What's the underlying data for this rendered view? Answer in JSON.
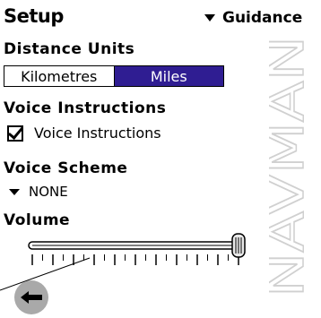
{
  "header": {
    "title": "Setup",
    "menu_label": "Guidance"
  },
  "distance": {
    "heading": "Distance Units",
    "options": [
      "Kilometres",
      "Miles"
    ],
    "selected": "Miles"
  },
  "voice": {
    "heading": "Voice Instructions",
    "checkbox_label": "Voice Instructions",
    "checked": true
  },
  "scheme": {
    "heading": "Voice Scheme",
    "value": "NONE"
  },
  "volume": {
    "heading": "Volume",
    "level": 1.0
  },
  "brand": {
    "text": "NAVMAN"
  },
  "icons": {
    "back": "back-arrow-icon",
    "menu": "triangle-down-icon",
    "checkbox": "checkmark-icon"
  },
  "colors": {
    "selected_bg": "#2f1d92",
    "button_bg": "#a9a9a9"
  }
}
